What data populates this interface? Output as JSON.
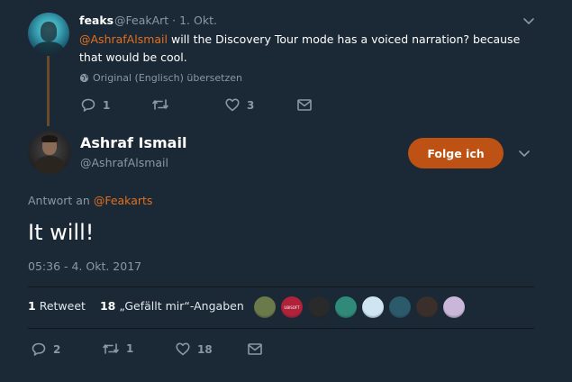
{
  "parent_tweet": {
    "name": "feaks",
    "handle_date": "@FeakArt · 1. Okt.",
    "mention": "@AshrafAlsmail",
    "text": " will the Discovery Tour mode has a voiced narration? because that would be cool.",
    "translate_label": "Original (Englisch) übersetzen",
    "actions": {
      "replies": "1",
      "retweets": "",
      "likes": "3"
    }
  },
  "main_tweet": {
    "name": "Ashraf Ismail",
    "handle": "@AshrafAlsmail",
    "follow_label": "Folge ich",
    "reply_prefix": "Antwort an ",
    "reply_to": "@Feakarts",
    "text": "It will!",
    "timestamp": "05:36 - 4. Okt. 2017",
    "stats": {
      "retweets_count": "1",
      "retweets_label": "Retweet",
      "likes_count": "18",
      "likes_label": "„Gefällt mir“-Angaben"
    },
    "likers": [
      "#6b7a4a",
      "#b0213a",
      "#2a2a2a",
      "#2f8a7a",
      "#cfe6f2",
      "#2b5b6b",
      "#3a2f2a",
      "#c9b6d9"
    ],
    "likers_extra": {
      "ubisoft_text": "UBISOFT"
    },
    "actions": {
      "replies": "2",
      "retweets": "1",
      "likes": "18"
    }
  },
  "colors": {
    "background": "#1b2836",
    "accent": "#e0701f",
    "follow": "#bd5214",
    "muted": "#8899a6"
  }
}
